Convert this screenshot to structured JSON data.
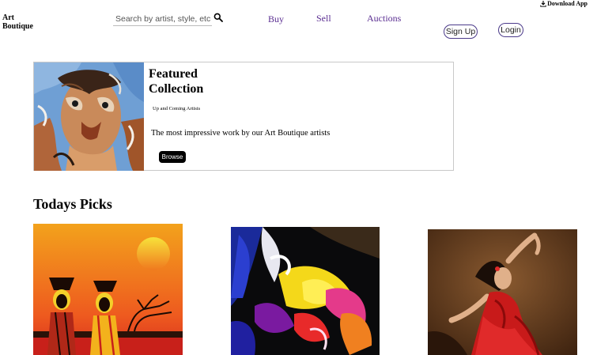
{
  "header": {
    "download_label": "Download App",
    "logo_line1": "Art",
    "logo_line2": "Boutique",
    "search_placeholder": "Search by artist, style, etc"
  },
  "nav": {
    "buy": "Buy",
    "sell": "Sell",
    "auctions": "Auctions"
  },
  "auth": {
    "signup": "Sign Up",
    "login": "Login"
  },
  "featured": {
    "title_line1": "Featured",
    "title_line2": "Collection",
    "subtitle": "Up and Coming Artists",
    "description": "The most impressive work by our Art Boutique artists",
    "button": "Browse"
  },
  "picks": {
    "title": "Todays Picks"
  },
  "colors": {
    "nav_link": "#5a2d91",
    "pill_border": "#4b3a8a",
    "button_bg": "#000000"
  }
}
